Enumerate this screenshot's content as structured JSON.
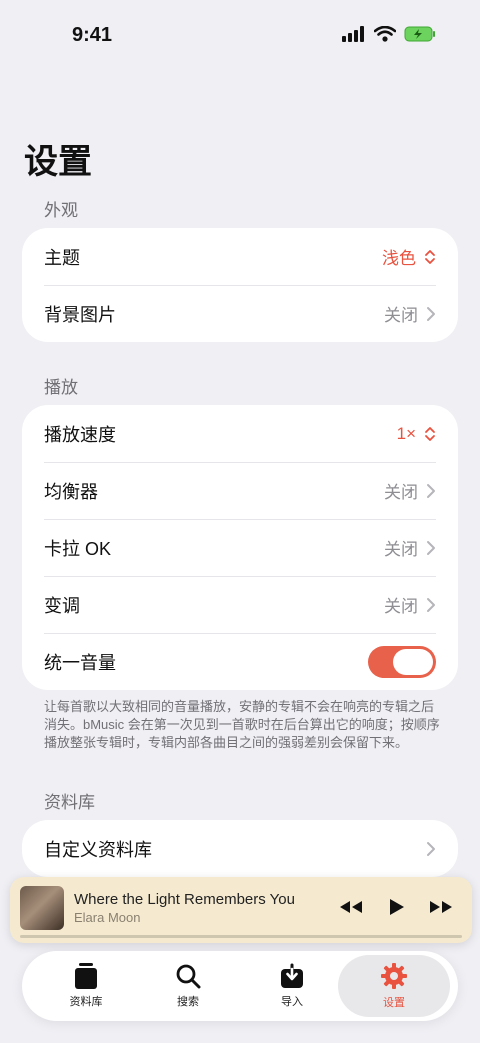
{
  "status_bar": {
    "time": "9:41"
  },
  "page": {
    "title": "设置"
  },
  "appearance": {
    "header": "外观",
    "rows": [
      {
        "label": "主题",
        "value": "浅色",
        "control": "popup"
      },
      {
        "label": "背景图片",
        "value": "关闭",
        "control": "chevron"
      }
    ]
  },
  "playback": {
    "header": "播放",
    "rows": [
      {
        "label": "播放速度",
        "value": "1×",
        "control": "popup"
      },
      {
        "label": "均衡器",
        "value": "关闭",
        "control": "chevron"
      },
      {
        "label": "卡拉 OK",
        "value": "关闭",
        "control": "chevron"
      },
      {
        "label": "变调",
        "value": "关闭",
        "control": "chevron"
      },
      {
        "label": "统一音量",
        "value": true,
        "control": "toggle"
      }
    ],
    "footnote": "让每首歌以大致相同的音量播放，安静的专辑不会在响亮的专辑之后消失。bMusic 会在第一次见到一首歌时在后台算出它的响度；按顺序播放整张专辑时，专辑内部各曲目之间的强弱差别会保留下来。"
  },
  "library": {
    "header": "资料库",
    "rows": [
      {
        "label": "自定义资料库",
        "control": "chevron"
      }
    ]
  },
  "now_playing": {
    "title": "Where the Light Remembers You",
    "artist": "Elara Moon",
    "progress": 0.0
  },
  "tabbar": {
    "items": [
      {
        "label": "资料库",
        "icon": "library-icon",
        "active": false
      },
      {
        "label": "搜索",
        "icon": "search-icon",
        "active": false
      },
      {
        "label": "导入",
        "icon": "import-icon",
        "active": false
      },
      {
        "label": "设置",
        "icon": "gear-icon",
        "active": true
      }
    ]
  },
  "colors": {
    "accent": "#e8523f",
    "background": "#efeff4",
    "mini_player": "#f5ead0"
  }
}
